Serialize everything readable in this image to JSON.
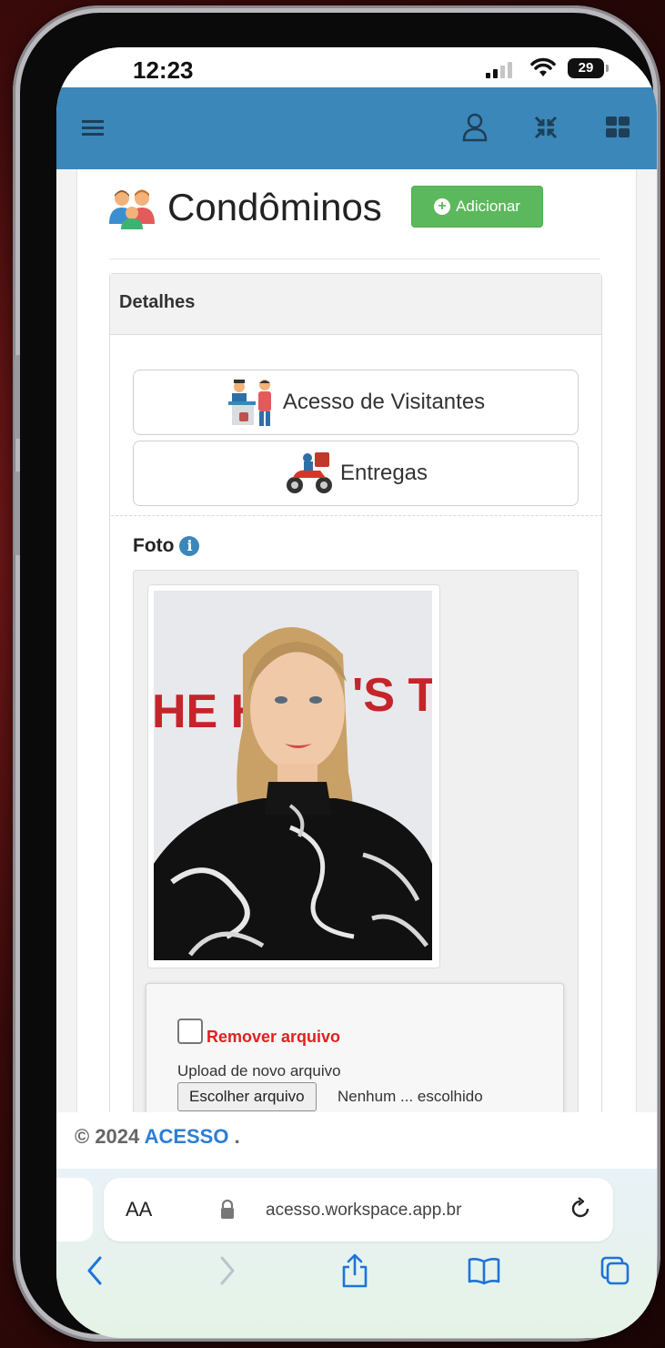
{
  "status_bar": {
    "time": "12:23",
    "battery": "29"
  },
  "header": {
    "icons": [
      "menu-icon",
      "user-icon",
      "compress-icon",
      "grid-icon"
    ],
    "color": "#3b87b9"
  },
  "page": {
    "title": "Condôminos",
    "add_button": "Adicionar"
  },
  "panel": {
    "heading": "Detalhes",
    "buttons": [
      {
        "label": "Acesso de Visitantes",
        "icon": "visitors-icon"
      },
      {
        "label": "Entregas",
        "icon": "delivery-scooter-icon"
      }
    ],
    "foto_label": "Foto",
    "photo_text": "HE HA",
    "photo_text2": "'S TAL",
    "remove_label": "Remover arquivo",
    "upload_label": "Upload de novo arquivo",
    "choose_button": "Escolher arquivo",
    "no_file": "Nenhum ... escolhido"
  },
  "footer": {
    "copyright": "© 2024",
    "brand": "ACESSO",
    "suffix": "."
  },
  "browser": {
    "aa_label": "AA",
    "url": "acesso.workspace.app.br",
    "nav_icons": [
      "back-icon",
      "forward-icon",
      "share-icon",
      "bookmarks-icon",
      "tabs-icon"
    ]
  },
  "colors": {
    "accent": "#3b87b9",
    "success": "#5cb85c",
    "danger": "#e02020",
    "brand": "#2b7fd4"
  }
}
